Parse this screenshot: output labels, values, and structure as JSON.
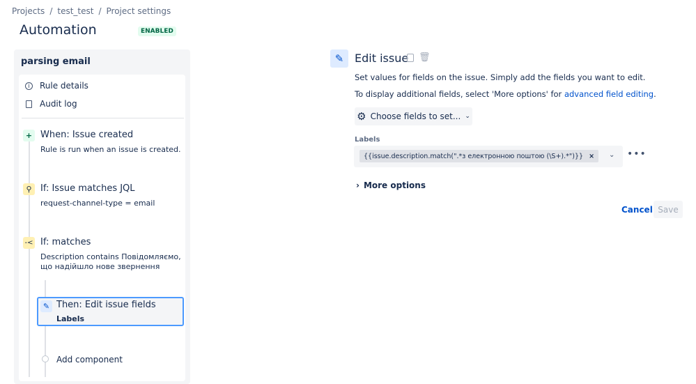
{
  "breadcrumb": [
    "Projects",
    "test_test",
    "Project settings"
  ],
  "page": {
    "title": "Automation",
    "status": "ENABLED"
  },
  "rule": {
    "name": "parsing email",
    "nav": [
      "Rule details",
      "Audit log"
    ],
    "steps": [
      {
        "title": "When: Issue created",
        "desc": "Rule is run when an issue is created."
      },
      {
        "title": "If: Issue matches JQL",
        "desc": "request-channel-type = email"
      },
      {
        "title": "If: matches",
        "desc": "Description contains Повідомляємо, що надійшло нове звернення"
      },
      {
        "title": "Then: Edit issue fields",
        "desc": "Labels"
      }
    ],
    "add_component": "Add component"
  },
  "editor": {
    "title": "Edit issue",
    "desc1": "Set values for fields on the issue. Simply add the fields you want to edit.",
    "desc2": "To display additional fields, select 'More options' for ",
    "desc2_link": "advanced field editing",
    "desc2_end": ".",
    "choose_fields": "Choose fields to set...",
    "field_label": "Labels",
    "label_value": "{{issue.description.match(\".*з електронною поштою (\\S+).*\")}}",
    "more_options": "More options",
    "cancel": "Cancel",
    "save": "Save"
  },
  "colors": {
    "accent": "#0052cc",
    "enabled_bg": "#e3fcef",
    "selected_border": "#4c9aff"
  }
}
